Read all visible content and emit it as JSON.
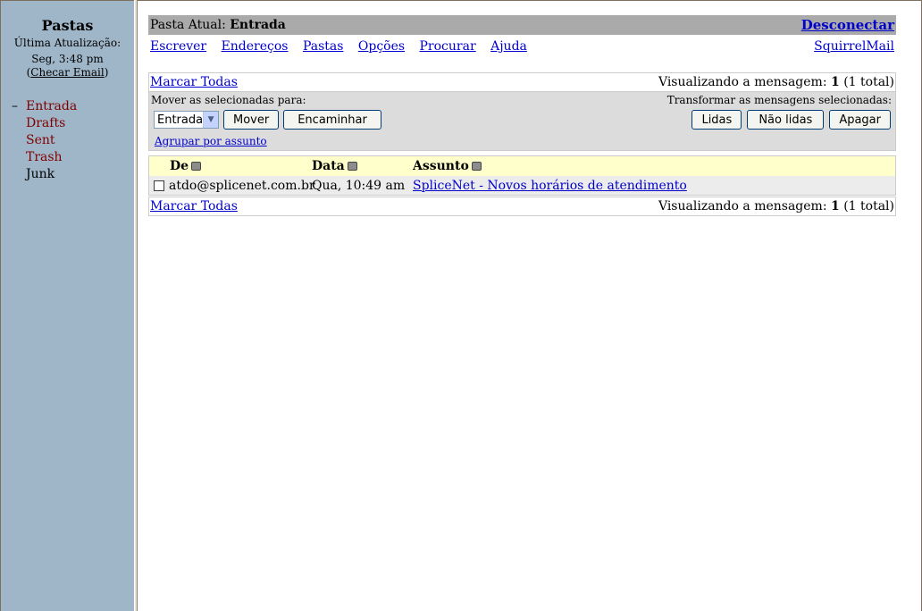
{
  "sidebar": {
    "title": "Pastas",
    "last_update_label": "Última Atualização:",
    "last_update_time": "Seg, 3:48 pm",
    "check_email_open": "(",
    "check_email": "Checar Email",
    "check_email_close": ")",
    "folders": [
      {
        "marker": "–",
        "name": "Entrada"
      },
      {
        "marker": "",
        "name": "Drafts"
      },
      {
        "marker": "",
        "name": "Sent"
      },
      {
        "marker": "",
        "name": "Trash"
      },
      {
        "marker": "",
        "name": "Junk"
      }
    ]
  },
  "header": {
    "current_folder_label": "Pasta Atual: ",
    "current_folder": "Entrada",
    "logout": "Desconectar"
  },
  "nav": {
    "links": [
      "Escrever",
      "Endereços",
      "Pastas",
      "Opções",
      "Procurar",
      "Ajuda"
    ],
    "brand": "SquirrelMail"
  },
  "list_bar": {
    "mark_all": "Marcar Todas",
    "viewing_prefix": "Visualizando a mensagem: ",
    "viewing_count": "1",
    "viewing_suffix": " (1 total)"
  },
  "controls": {
    "move_label": "Mover as selecionadas para:",
    "move_target": "Entrada",
    "move_button": "Mover",
    "forward_button": "Encaminhar",
    "transform_label": "Transformar as mensagens selecionadas:",
    "read_button": "Lidas",
    "unread_button": "Não lidas",
    "delete_button": "Apagar",
    "group_by_subject": "Agrupar por assunto"
  },
  "messages": {
    "headers": {
      "from": "De",
      "date": "Data",
      "subject": "Assunto"
    },
    "rows": [
      {
        "from": "atdo@splicenet.com.br",
        "date": "Qua, 10:49 am",
        "subject": "SpliceNet - Novos horários de atendimento"
      }
    ]
  }
}
